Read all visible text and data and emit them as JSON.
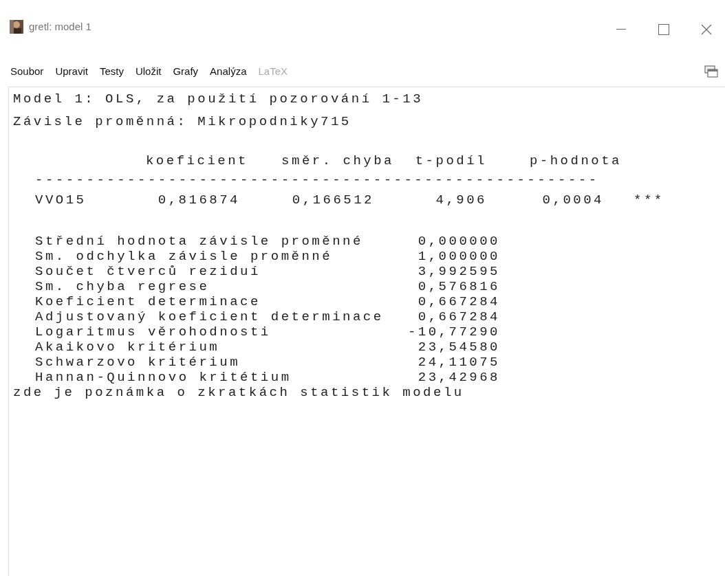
{
  "window": {
    "title": "gretl: model 1"
  },
  "menu": [
    {
      "label": "Soubor",
      "disabled": false
    },
    {
      "label": "Upravit",
      "disabled": false
    },
    {
      "label": "Testy",
      "disabled": false
    },
    {
      "label": "Uložit",
      "disabled": false
    },
    {
      "label": "Grafy",
      "disabled": false
    },
    {
      "label": "Analýza",
      "disabled": false
    },
    {
      "label": "LaTeX",
      "disabled": true
    }
  ],
  "output": {
    "heading": [
      "Model 1: OLS, za použití pozorování 1-13",
      "Závisle proměnná: Mikropodniky715"
    ],
    "table": {
      "columns": [
        "koeficient",
        "směr. chyba",
        "t-podíl",
        "p-hodnota"
      ],
      "separator": "-------------------------------------------------------",
      "rows": [
        {
          "name": "VVO15",
          "cells": [
            "0,816874",
            "0,166512",
            "4,906",
            "0,0004"
          ],
          "stars": "***"
        }
      ]
    },
    "stats": [
      {
        "label": "Střední hodnota závisle proměnné",
        "value": "0,000000"
      },
      {
        "label": "Sm. odchylka závisle proměnné",
        "value": "1,000000"
      },
      {
        "label": "Součet čtverců reziduí",
        "value": "3,992595"
      },
      {
        "label": "Sm. chyba regrese",
        "value": "0,576816"
      },
      {
        "label": "Koeficient determinace",
        "value": "0,667284"
      },
      {
        "label": "Adjustovaný koeficient determinace",
        "value": "0,667284"
      },
      {
        "label": "Logaritmus věrohodnosti",
        "value": "-10,77290"
      },
      {
        "label": "Akaikovo kritérium",
        "value": "23,54580"
      },
      {
        "label": "Schwarzovo kritérium",
        "value": "24,11075"
      },
      {
        "label": "Hannan-Quinnovo kritétium",
        "value": "23,42968"
      }
    ],
    "note": "zde je poznámka o zkratkách statistik modelu"
  }
}
